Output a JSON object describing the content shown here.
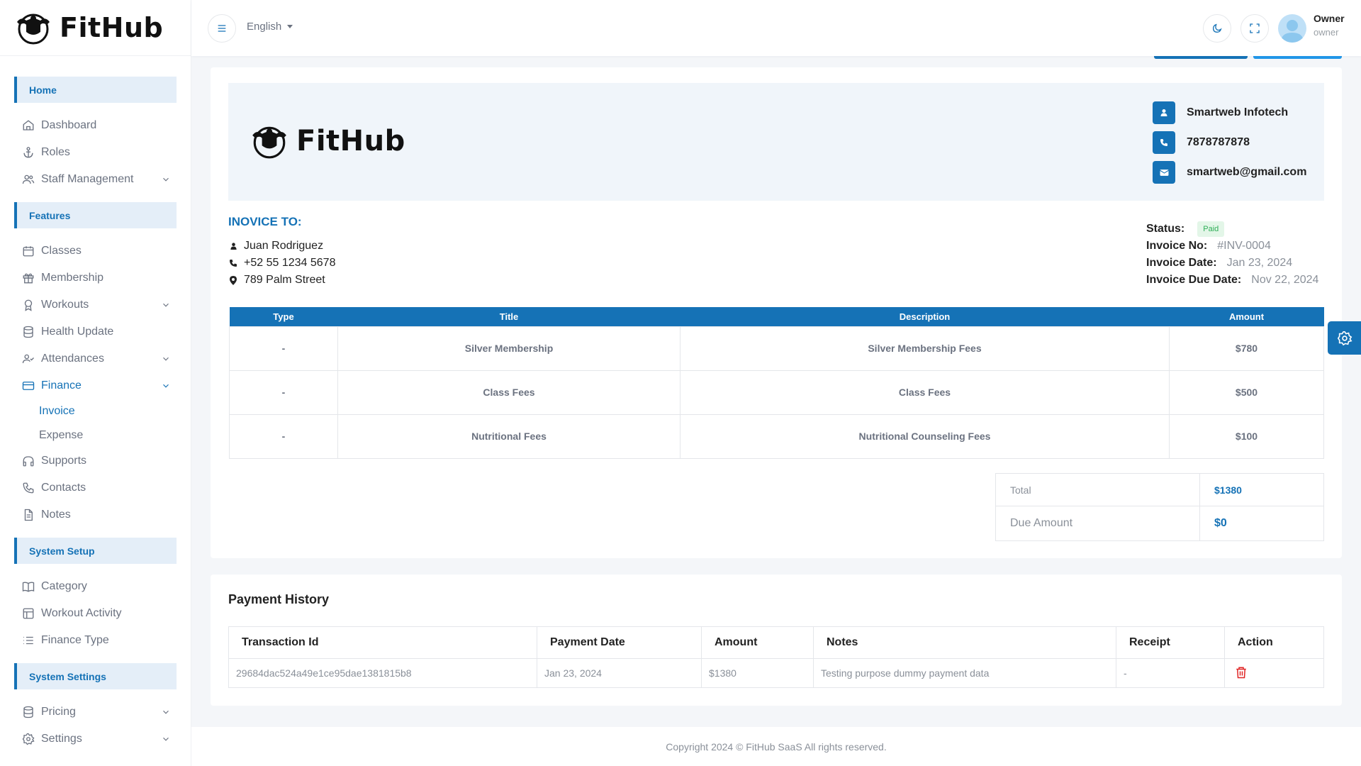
{
  "brand": {
    "name": "FitHub"
  },
  "header": {
    "language": "English",
    "user_name": "Owner",
    "user_role": "owner"
  },
  "sidebar": {
    "sections": [
      {
        "title": "Home",
        "items": [
          {
            "label": "Dashboard",
            "icon": "home-icon"
          },
          {
            "label": "Roles",
            "icon": "anchor-icon"
          },
          {
            "label": "Staff Management",
            "icon": "users-icon",
            "expandable": true
          }
        ]
      },
      {
        "title": "Features",
        "items": [
          {
            "label": "Classes",
            "icon": "calendar-icon"
          },
          {
            "label": "Membership",
            "icon": "gift-icon"
          },
          {
            "label": "Workouts",
            "icon": "award-icon",
            "expandable": true
          },
          {
            "label": "Health Update",
            "icon": "database-icon"
          },
          {
            "label": "Attendances",
            "icon": "user-check-icon",
            "expandable": true
          },
          {
            "label": "Finance",
            "icon": "credit-card-icon",
            "expandable": true,
            "active": true,
            "children": [
              {
                "label": "Invoice",
                "active": true
              },
              {
                "label": "Expense"
              }
            ]
          },
          {
            "label": "Supports",
            "icon": "headphones-icon"
          },
          {
            "label": "Contacts",
            "icon": "phone-icon"
          },
          {
            "label": "Notes",
            "icon": "file-icon"
          }
        ]
      },
      {
        "title": "System Setup",
        "items": [
          {
            "label": "Category",
            "icon": "book-icon"
          },
          {
            "label": "Workout Activity",
            "icon": "layout-icon"
          },
          {
            "label": "Finance Type",
            "icon": "list-icon"
          }
        ]
      },
      {
        "title": "System Settings",
        "items": [
          {
            "label": "Pricing",
            "icon": "database-icon",
            "expandable": true
          },
          {
            "label": "Settings",
            "icon": "gear-icon",
            "expandable": true
          }
        ]
      }
    ]
  },
  "invoice": {
    "company": {
      "name": "Smartweb Infotech",
      "phone": "7878787878",
      "email": "smartweb@gmail.com"
    },
    "to_heading": "INOVICE TO:",
    "customer": {
      "name": "Juan Rodriguez",
      "phone": "+52 55 1234 5678",
      "address": "789 Palm Street"
    },
    "status_label": "Status:",
    "status": "Paid",
    "number_label": "Invoice No:",
    "number": "#INV-0004",
    "date_label": "Invoice Date:",
    "date": "Jan 23, 2024",
    "due_label": "Invoice Due Date:",
    "due_date": "Nov 22, 2024",
    "columns": [
      "Type",
      "Title",
      "Description",
      "Amount"
    ],
    "rows": [
      {
        "type": "-",
        "title": "Silver Membership",
        "description": "Silver Membership Fees",
        "amount": "$780"
      },
      {
        "type": "-",
        "title": "Class Fees",
        "description": "Class Fees",
        "amount": "$500"
      },
      {
        "type": "-",
        "title": "Nutritional Fees",
        "description": "Nutritional Counseling Fees",
        "amount": "$100"
      }
    ],
    "total_label": "Total",
    "total": "$1380",
    "due_amount_label": "Due Amount",
    "due_amount": "$0"
  },
  "payment_history": {
    "title": "Payment History",
    "columns": [
      "Transaction Id",
      "Payment Date",
      "Amount",
      "Notes",
      "Receipt",
      "Action"
    ],
    "rows": [
      {
        "transaction_id": "29684dac524a49e1ce95dae1381815b8",
        "date": "Jan 23, 2024",
        "amount": "$1380",
        "notes": "Testing purpose dummy payment data",
        "receipt": "-",
        "action_icon": "trash-icon"
      }
    ]
  },
  "footer": {
    "text": "Copyright 2024 © FitHub SaaS All rights reserved."
  },
  "colors": {
    "accent": "#1572b6",
    "paid": "#2eae57",
    "danger": "#e02424"
  }
}
